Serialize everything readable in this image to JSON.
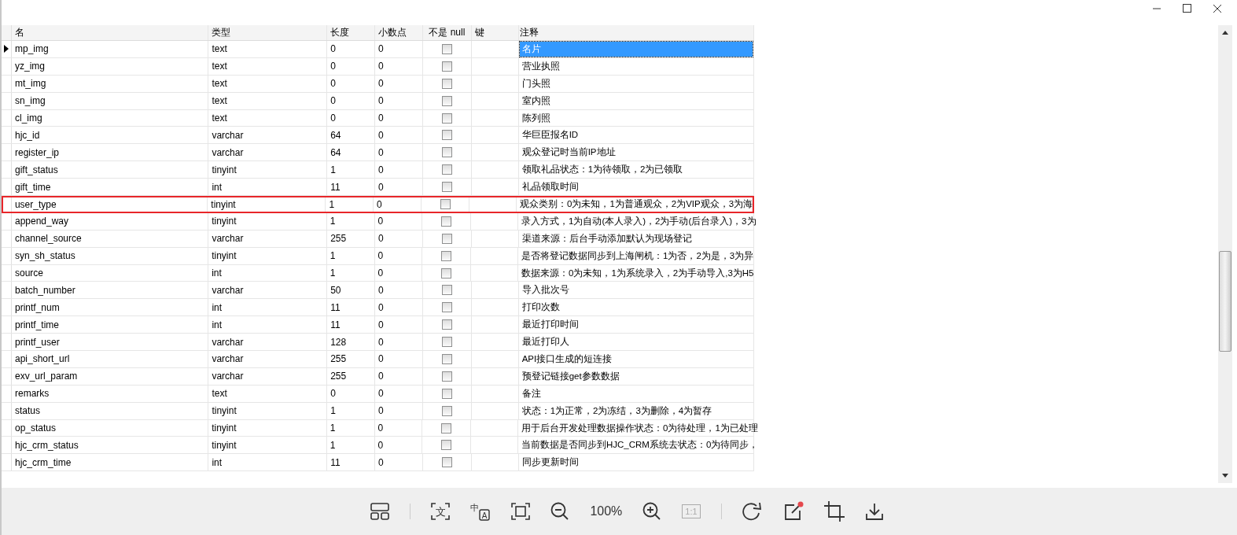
{
  "table": {
    "columns": [
      "名",
      "类型",
      "长度",
      "小数点",
      "不是 null",
      "键",
      "注释"
    ],
    "rows": [
      {
        "name": "mp_img",
        "type": "text",
        "length": "0",
        "decimals": "0",
        "not_null": false,
        "comment": "名片",
        "selected": true,
        "highlighted": false
      },
      {
        "name": "yz_img",
        "type": "text",
        "length": "0",
        "decimals": "0",
        "not_null": false,
        "comment": "营业执照",
        "selected": false,
        "highlighted": false
      },
      {
        "name": "mt_img",
        "type": "text",
        "length": "0",
        "decimals": "0",
        "not_null": false,
        "comment": "门头照",
        "selected": false,
        "highlighted": false
      },
      {
        "name": "sn_img",
        "type": "text",
        "length": "0",
        "decimals": "0",
        "not_null": false,
        "comment": "室内照",
        "selected": false,
        "highlighted": false
      },
      {
        "name": "cl_img",
        "type": "text",
        "length": "0",
        "decimals": "0",
        "not_null": false,
        "comment": "陈列照",
        "selected": false,
        "highlighted": false
      },
      {
        "name": "hjc_id",
        "type": "varchar",
        "length": "64",
        "decimals": "0",
        "not_null": false,
        "comment": "华巨臣报名ID",
        "selected": false,
        "highlighted": false
      },
      {
        "name": "register_ip",
        "type": "varchar",
        "length": "64",
        "decimals": "0",
        "not_null": false,
        "comment": "观众登记时当前IP地址",
        "selected": false,
        "highlighted": false
      },
      {
        "name": "gift_status",
        "type": "tinyint",
        "length": "1",
        "decimals": "0",
        "not_null": false,
        "comment": "领取礼品状态：1为待领取，2为已领取",
        "selected": false,
        "highlighted": false
      },
      {
        "name": "gift_time",
        "type": "int",
        "length": "11",
        "decimals": "0",
        "not_null": false,
        "comment": "礼品领取时间",
        "selected": false,
        "highlighted": false
      },
      {
        "name": "user_type",
        "type": "tinyint",
        "length": "1",
        "decimals": "0",
        "not_null": false,
        "comment": "观众类别：0为未知，1为普通观众，2为VIP观众，3为海",
        "selected": false,
        "highlighted": true
      },
      {
        "name": "append_way",
        "type": "tinyint",
        "length": "1",
        "decimals": "0",
        "not_null": false,
        "comment": "录入方式，1为自动(本人录入)，2为手动(后台录入)，3为",
        "selected": false,
        "highlighted": false
      },
      {
        "name": "channel_source",
        "type": "varchar",
        "length": "255",
        "decimals": "0",
        "not_null": false,
        "comment": "渠道来源：后台手动添加默认为现场登记",
        "selected": false,
        "highlighted": false
      },
      {
        "name": "syn_sh_status",
        "type": "tinyint",
        "length": "1",
        "decimals": "0",
        "not_null": false,
        "comment": "是否将登记数据同步到上海闸机：1为否，2为是，3为异",
        "selected": false,
        "highlighted": false
      },
      {
        "name": "source",
        "type": "int",
        "length": "1",
        "decimals": "0",
        "not_null": false,
        "comment": "数据来源：0为未知，1为系统录入，2为手动导入,3为H5",
        "selected": false,
        "highlighted": false
      },
      {
        "name": "batch_number",
        "type": "varchar",
        "length": "50",
        "decimals": "0",
        "not_null": false,
        "comment": "导入批次号",
        "selected": false,
        "highlighted": false
      },
      {
        "name": "printf_num",
        "type": "int",
        "length": "11",
        "decimals": "0",
        "not_null": false,
        "comment": "打印次数",
        "selected": false,
        "highlighted": false
      },
      {
        "name": "printf_time",
        "type": "int",
        "length": "11",
        "decimals": "0",
        "not_null": false,
        "comment": "最近打印时间",
        "selected": false,
        "highlighted": false
      },
      {
        "name": "printf_user",
        "type": "varchar",
        "length": "128",
        "decimals": "0",
        "not_null": false,
        "comment": "最近打印人",
        "selected": false,
        "highlighted": false
      },
      {
        "name": "api_short_url",
        "type": "varchar",
        "length": "255",
        "decimals": "0",
        "not_null": false,
        "comment": "API接口生成的短连接",
        "selected": false,
        "highlighted": false
      },
      {
        "name": "exv_url_param",
        "type": "varchar",
        "length": "255",
        "decimals": "0",
        "not_null": false,
        "comment": "预登记链接get参数数据",
        "selected": false,
        "highlighted": false
      },
      {
        "name": "remarks",
        "type": "text",
        "length": "0",
        "decimals": "0",
        "not_null": false,
        "comment": "备注",
        "selected": false,
        "highlighted": false
      },
      {
        "name": "status",
        "type": "tinyint",
        "length": "1",
        "decimals": "0",
        "not_null": false,
        "comment": "状态：1为正常，2为冻结，3为删除，4为暂存",
        "selected": false,
        "highlighted": false
      },
      {
        "name": "op_status",
        "type": "tinyint",
        "length": "1",
        "decimals": "0",
        "not_null": false,
        "comment": "用于后台开发处理数据操作状态：0为待处理，1为已处理",
        "selected": false,
        "highlighted": false
      },
      {
        "name": "hjc_crm_status",
        "type": "tinyint",
        "length": "1",
        "decimals": "0",
        "not_null": false,
        "comment": "当前数据是否同步到HJC_CRM系统去状态：0为待同步，",
        "selected": false,
        "highlighted": false
      },
      {
        "name": "hjc_crm_time",
        "type": "int",
        "length": "11",
        "decimals": "0",
        "not_null": false,
        "comment": "同步更新时间",
        "selected": false,
        "highlighted": false
      }
    ]
  },
  "toolbar": {
    "ocr_glyph": "文",
    "translate_glyphs": [
      "中",
      "A"
    ],
    "zoom_level": "100%",
    "actual_size": {
      "label": "1:1",
      "disabled": true
    },
    "edit_badge": true
  }
}
